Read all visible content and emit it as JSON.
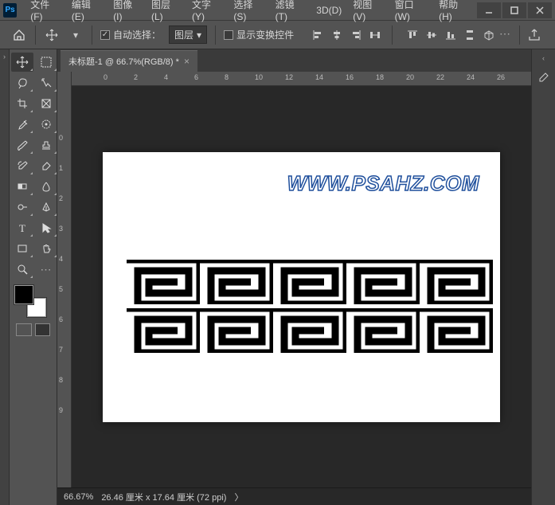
{
  "app": {
    "logo": "Ps"
  },
  "menu": {
    "file": "文件(F)",
    "edit": "编辑(E)",
    "image": "图像(I)",
    "layer": "图层(L)",
    "type": "文字(Y)",
    "select": "选择(S)",
    "filter": "滤镜(T)",
    "threeD": "3D(D)",
    "view": "视图(V)",
    "window": "窗口(W)",
    "help": "帮助(H)"
  },
  "options": {
    "auto_select": "自动选择：",
    "target_dropdown": "图层",
    "show_transform": "显示变换控件"
  },
  "document": {
    "tab_title": "未标题-1 @ 66.7%(RGB/8) *",
    "watermark": "WWW.PSAHZ.COM"
  },
  "ruler_h": [
    "0",
    "2",
    "4",
    "6",
    "8",
    "10",
    "12",
    "14",
    "16",
    "18",
    "20",
    "22",
    "24",
    "26"
  ],
  "ruler_v": [
    "0",
    "1",
    "2",
    "3",
    "4",
    "5",
    "6",
    "7",
    "8",
    "9"
  ],
  "status": {
    "zoom": "66.67%",
    "dims": "26.46 厘米 x 17.64 厘米 (72 ppi)",
    "arrow": "〉"
  },
  "colors": {
    "fg": "#000000",
    "bg": "#ffffff"
  }
}
